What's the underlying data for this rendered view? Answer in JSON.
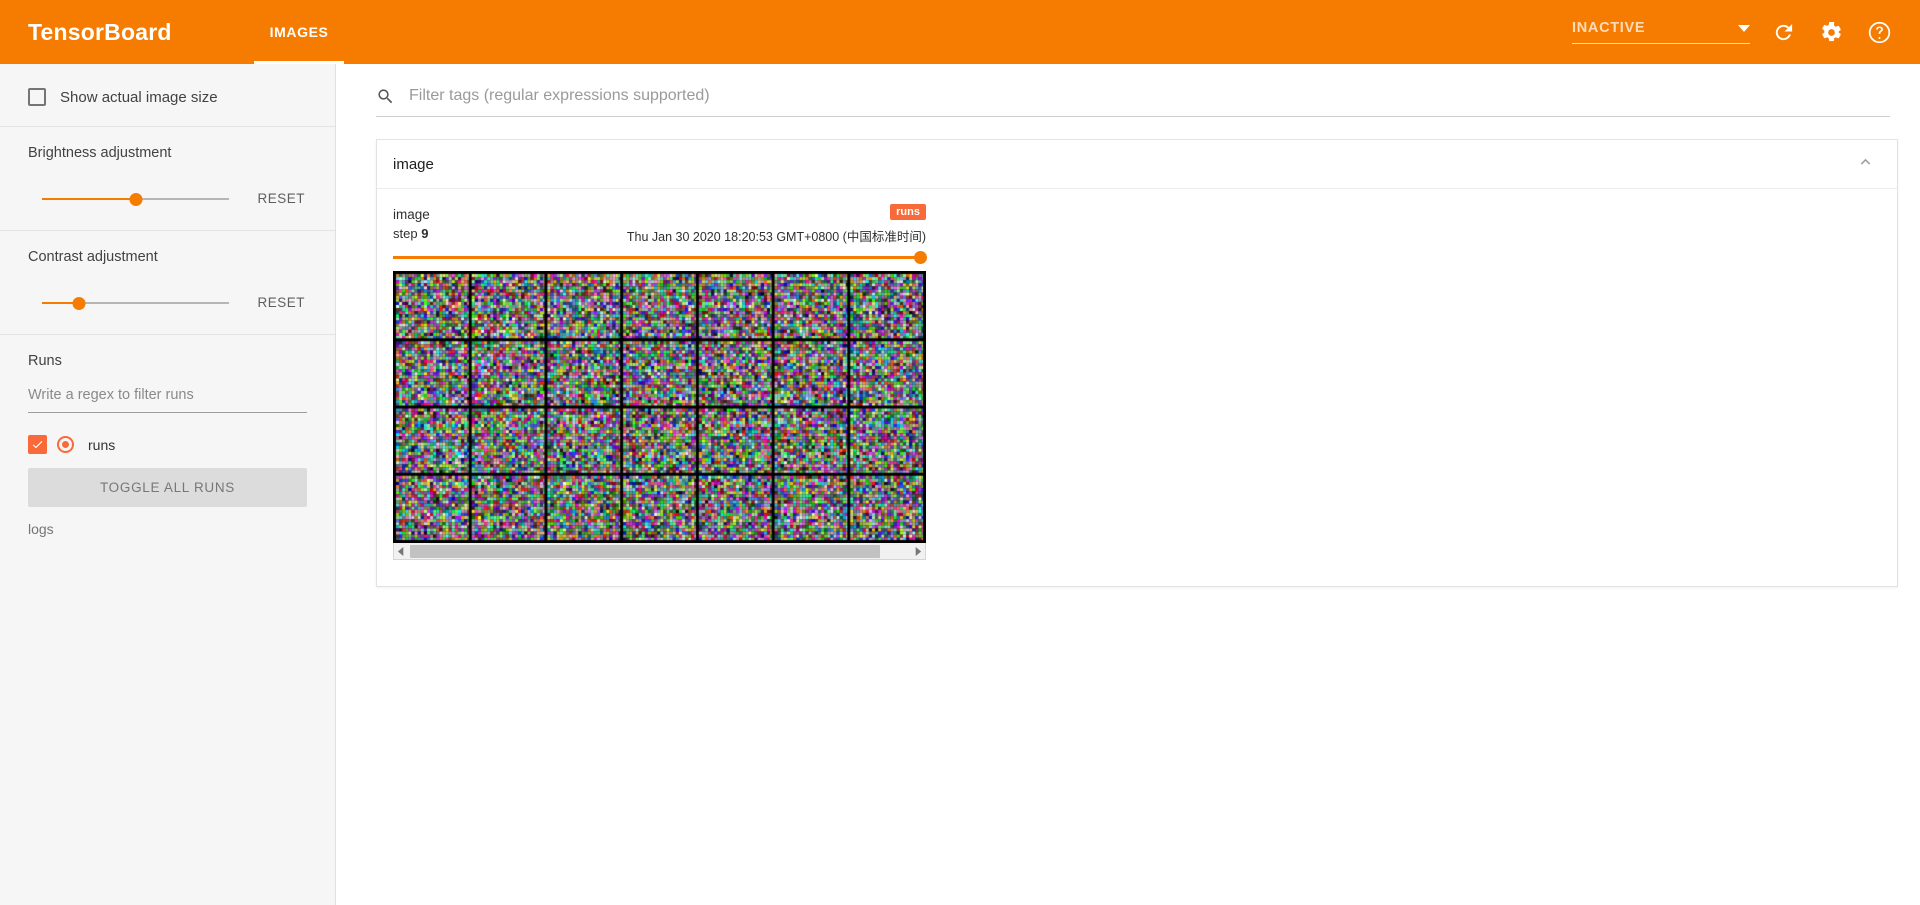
{
  "header": {
    "brand": "TensorBoard",
    "tabs": [
      {
        "label": "IMAGES",
        "active": true
      }
    ],
    "run_selector": {
      "value": "INACTIVE",
      "icon": "chevron-down-icon"
    },
    "actions": [
      {
        "name": "refresh-icon",
        "title": "Refresh"
      },
      {
        "name": "gear-icon",
        "title": "Settings"
      },
      {
        "name": "help-icon",
        "title": "Help"
      }
    ],
    "accent_color": "#f57c00"
  },
  "sidebar": {
    "show_actual_image_size": {
      "label": "Show actual image size",
      "checked": false
    },
    "brightness": {
      "label": "Brightness adjustment",
      "reset_label": "RESET",
      "value_percent": 50
    },
    "contrast": {
      "label": "Contrast adjustment",
      "reset_label": "RESET",
      "value_percent": 20
    },
    "runs": {
      "title": "Runs",
      "filter_placeholder": "Write a regex to filter runs",
      "filter_value": "",
      "items": [
        {
          "name": "runs",
          "checked": true,
          "color": "#f96a3a"
        }
      ],
      "toggle_all_label": "TOGGLE ALL RUNS",
      "logs_label": "logs"
    }
  },
  "main": {
    "search": {
      "placeholder": "Filter tags (regular expressions supported)",
      "value": "",
      "icon": "search-icon"
    },
    "card": {
      "title": "image",
      "collapse_icon": "chevron-up-icon",
      "image": {
        "tag": "image",
        "step_label": "step",
        "step_value": "9",
        "timestamp": "Thu Jan 30 2020 18:20:53 GMT+0800 (中国标准时间)",
        "run_badge": "runs",
        "slider_position_percent": 100,
        "grid": {
          "rows": 4,
          "cols": 7,
          "content": "random-rgb-noise"
        }
      },
      "scrollbar": {
        "left_arrow": "scroll-left-icon",
        "right_arrow": "scroll-right-icon",
        "thumb_percent": 95
      }
    }
  }
}
